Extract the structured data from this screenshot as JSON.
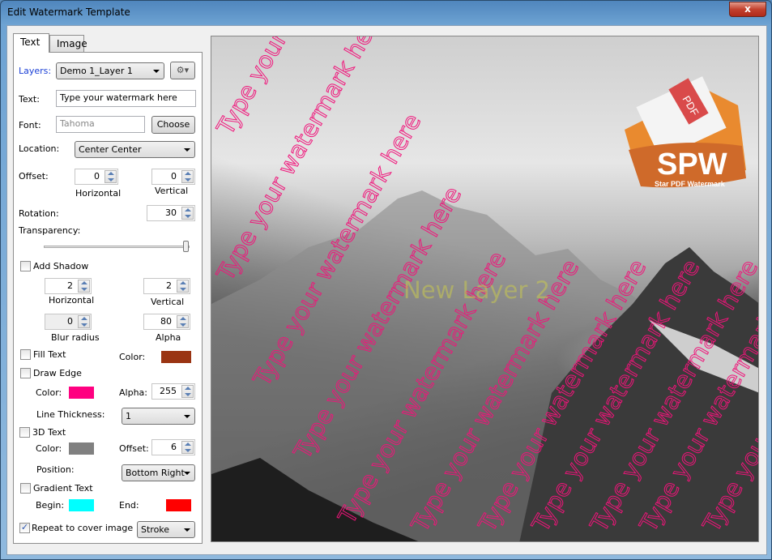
{
  "window": {
    "title": "Edit Watermark Template",
    "close": "x"
  },
  "tabs": [
    "Text",
    "Image"
  ],
  "form": {
    "layers_label": "Layers:",
    "layers_value": "Demo 1_Layer 1",
    "text_label": "Text:",
    "text_value": "Type your watermark here",
    "font_label": "Font:",
    "font_value": "Tahoma",
    "choose": "Choose",
    "location_label": "Location:",
    "location_value": "Center Center",
    "offset_label": "Offset:",
    "offset_h": "0",
    "offset_v": "0",
    "horizontal": "Horizontal",
    "vertical": "Vertical",
    "rotation_label": "Rotation:",
    "rotation": "30",
    "transparency_label": "Transparency:",
    "transparency": 1.0,
    "shadow": {
      "label": "Add Shadow",
      "checked": false,
      "h": "2",
      "v": "2",
      "blur": "0",
      "alpha": "80",
      "horizontal": "Horizontal",
      "vertical": "Vertical",
      "blur_label": "Blur radius",
      "alpha_label": "Alpha"
    },
    "fill": {
      "label": "Fill Text",
      "checked": false,
      "color_label": "Color:",
      "color": "#9a3412"
    },
    "edge": {
      "label": "Draw Edge",
      "checked": false,
      "color_label": "Color:",
      "color": "#ff0080",
      "alpha_label": "Alpha:",
      "alpha": "255",
      "thickness_label": "Line Thickness:",
      "thickness": "1"
    },
    "d3": {
      "label": "3D Text",
      "checked": false,
      "color_label": "Color:",
      "color": "#808080",
      "offset_label": "Offset:",
      "offset": "6",
      "position_label": "Position:",
      "position": "Bottom Right"
    },
    "gradient": {
      "label": "Gradient Text",
      "checked": false,
      "begin_label": "Begin:",
      "begin": "#00ffff",
      "end_label": "End:",
      "end": "#ff0000"
    },
    "repeat": {
      "label": "Repeat to cover image",
      "checked": true,
      "mode": "Stroke"
    }
  },
  "preview": {
    "watermark": "Type your watermark here",
    "layer2": "New Layer 2",
    "logo_big": "SPW",
    "logo_small": "Star PDF Watermark",
    "logo_tag": "PDF",
    "edge_color": "#f0147a"
  }
}
